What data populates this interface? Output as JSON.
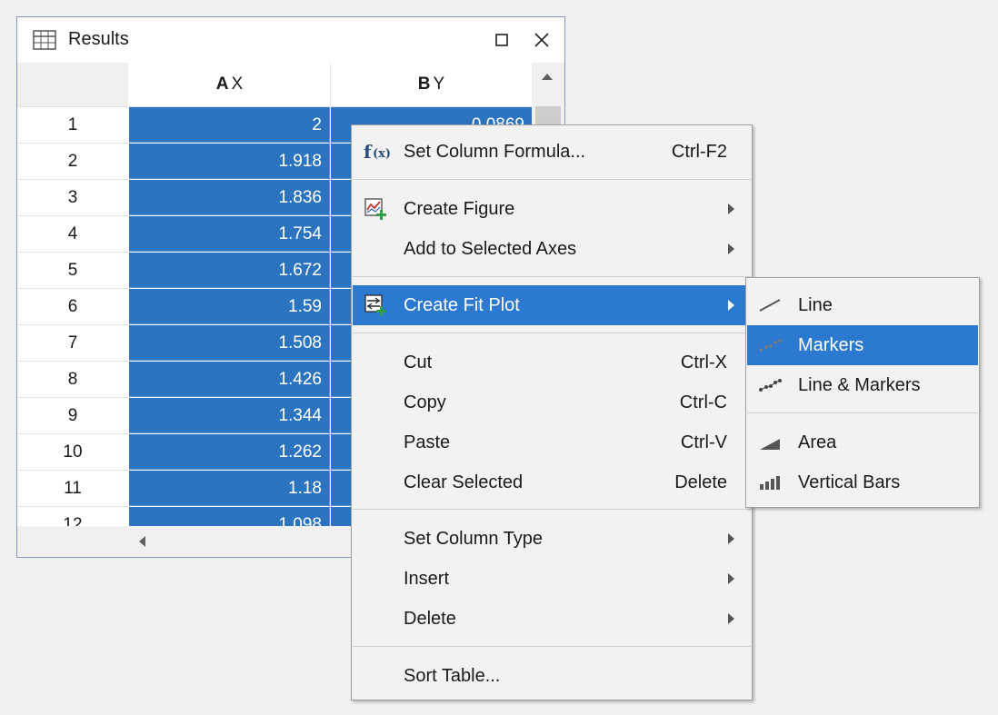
{
  "window": {
    "title": "Results",
    "icon": "table-icon",
    "maximize_icon": "maximize-icon",
    "close_icon": "close-icon"
  },
  "table": {
    "columns": [
      {
        "letter": "A",
        "name": "X"
      },
      {
        "letter": "B",
        "name": "Y"
      }
    ],
    "rows": [
      {
        "n": "1",
        "a": "2",
        "b": "0.0869"
      },
      {
        "n": "2",
        "a": "1.918",
        "b": ""
      },
      {
        "n": "3",
        "a": "1.836",
        "b": ""
      },
      {
        "n": "4",
        "a": "1.754",
        "b": ""
      },
      {
        "n": "5",
        "a": "1.672",
        "b": ""
      },
      {
        "n": "6",
        "a": "1.59",
        "b": ""
      },
      {
        "n": "7",
        "a": "1.508",
        "b": ""
      },
      {
        "n": "8",
        "a": "1.426",
        "b": ""
      },
      {
        "n": "9",
        "a": "1.344",
        "b": ""
      },
      {
        "n": "10",
        "a": "1.262",
        "b": ""
      },
      {
        "n": "11",
        "a": "1.18",
        "b": ""
      },
      {
        "n": "12",
        "a": "1.098",
        "b": ""
      }
    ]
  },
  "context_menu": {
    "items": [
      {
        "label": "Set Column Formula...",
        "shortcut": "Ctrl-F2",
        "icon": "formula-icon"
      },
      {
        "label": "Create Figure",
        "submenu": true,
        "icon": "create-figure-icon"
      },
      {
        "label": "Add to Selected Axes",
        "submenu": true
      },
      {
        "label": "Create Fit Plot",
        "submenu": true,
        "icon": "fit-plot-icon",
        "highlighted": true
      },
      {
        "label": "Cut",
        "shortcut": "Ctrl-X"
      },
      {
        "label": "Copy",
        "shortcut": "Ctrl-C"
      },
      {
        "label": "Paste",
        "shortcut": "Ctrl-V"
      },
      {
        "label": "Clear Selected",
        "shortcut": "Delete"
      },
      {
        "label": "Set Column Type",
        "submenu": true
      },
      {
        "label": "Insert",
        "submenu": true
      },
      {
        "label": "Delete",
        "submenu": true
      },
      {
        "label": "Sort Table..."
      }
    ]
  },
  "submenu": {
    "items": [
      {
        "label": "Line",
        "icon": "line-icon"
      },
      {
        "label": "Markers",
        "icon": "markers-icon",
        "highlighted": true
      },
      {
        "label": "Line & Markers",
        "icon": "line-markers-icon"
      },
      {
        "label": "Area",
        "icon": "area-icon"
      },
      {
        "label": "Vertical Bars",
        "icon": "vertical-bars-icon"
      }
    ]
  },
  "colors": {
    "selection": "#2c73c0",
    "menu_highlight": "#2b79d1",
    "menu_background": "#f2f2f2"
  }
}
